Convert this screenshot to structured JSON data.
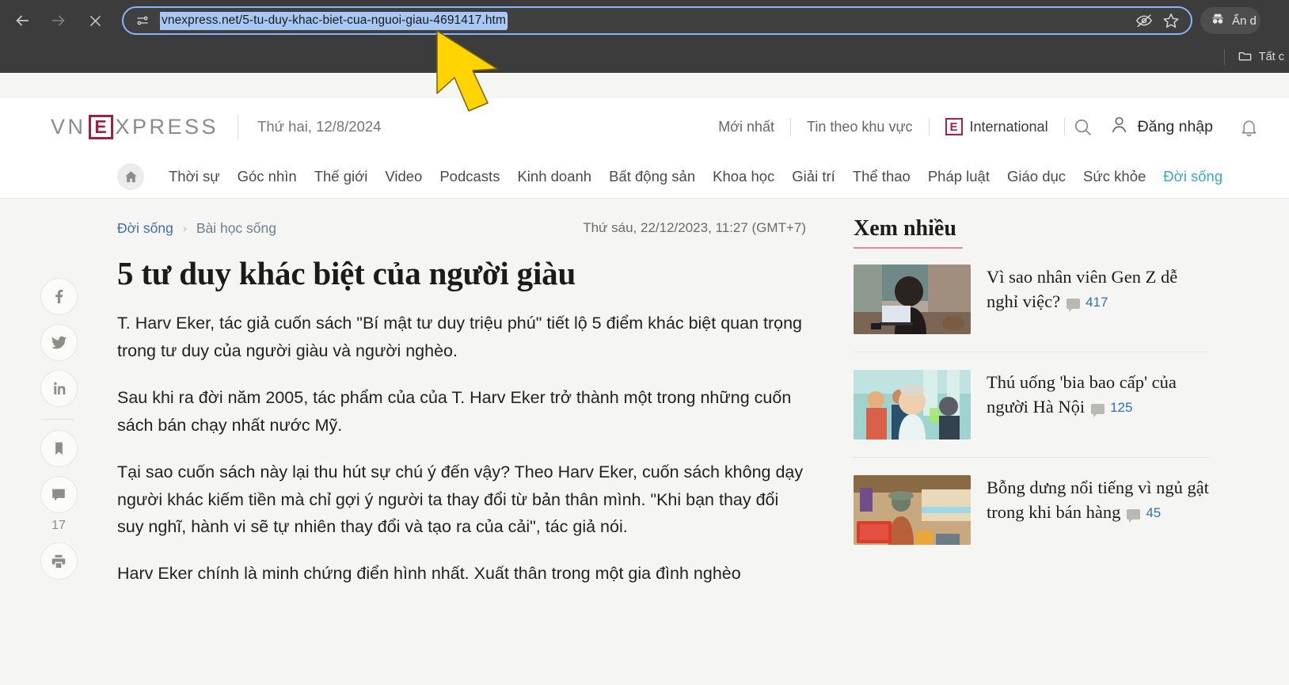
{
  "browser": {
    "back_label": "←",
    "forward_label": "→",
    "stop_label": "✕",
    "url": "vnexpress.net/5-tu-duy-khac-biet-cua-nguoi-giau-4691417.html",
    "lead_icon": "tune-sliders-icon",
    "hide_icon": "eye-slash-icon",
    "bookmark_star_icon": "star-icon",
    "incognito_label": "Ẩn d",
    "bookmark_folder_label": "Tất c",
    "accent_focus": "#8ab4f8",
    "chrome_bg": "#3c3c3c",
    "selection_bg": "#a7c8f5"
  },
  "site_header": {
    "logo_prefix": "VN",
    "logo_box": "E",
    "logo_suffix": "XPRESS",
    "date": "Thứ hai, 12/8/2024",
    "links": [
      "Mới nhất",
      "Tin theo khu vực"
    ],
    "international_label": "International",
    "international_badge": "E",
    "search_icon": "search-icon",
    "login_label": "Đăng nhập",
    "user_icon": "user-icon",
    "bell_icon": "bell-icon",
    "brand_color": "#9f1f45"
  },
  "nav": {
    "home_icon": "home-icon",
    "items": [
      {
        "label": "Thời sự",
        "active": false
      },
      {
        "label": "Góc nhìn",
        "active": false
      },
      {
        "label": "Thế giới",
        "active": false
      },
      {
        "label": "Video",
        "active": false
      },
      {
        "label": "Podcasts",
        "active": false
      },
      {
        "label": "Kinh doanh",
        "active": false
      },
      {
        "label": "Bất động sản",
        "active": false
      },
      {
        "label": "Khoa học",
        "active": false
      },
      {
        "label": "Giải trí",
        "active": false
      },
      {
        "label": "Thể thao",
        "active": false
      },
      {
        "label": "Pháp luật",
        "active": false
      },
      {
        "label": "Giáo dục",
        "active": false
      },
      {
        "label": "Sức khỏe",
        "active": false
      },
      {
        "label": "Đời sống",
        "active": true
      }
    ],
    "menu_icon": "hamburger-icon",
    "active_color": "#3aa7c4"
  },
  "share_rail": {
    "buttons": [
      {
        "name": "facebook-icon",
        "glyph": "f"
      },
      {
        "name": "twitter-icon",
        "glyph": "t"
      },
      {
        "name": "linkedin-icon",
        "glyph": "in"
      },
      {
        "name": "bookmark-icon",
        "glyph": "bm"
      },
      {
        "name": "comment-icon",
        "glyph": "cm"
      },
      {
        "name": "print-icon",
        "glyph": "pr"
      }
    ],
    "comment_count": "17"
  },
  "article": {
    "breadcrumb": {
      "category": "Đời sống",
      "separator": "›",
      "subcategory": "Bài học sống"
    },
    "timestamp": "Thứ sáu, 22/12/2023, 11:27 (GMT+7)",
    "title": "5 tư duy khác biệt của người giàu",
    "paragraphs": [
      "T. Harv Eker, tác giả cuốn sách \"Bí mật tư duy triệu phú\" tiết lộ 5 điểm khác biệt quan trọng trong tư duy của người giàu và người nghèo.",
      "Sau khi ra đời năm 2005, tác phẩm của của T. Harv Eker trở thành một trong những cuốn sách bán chạy nhất nước Mỹ.",
      "Tại sao cuốn sách này lại thu hút sự chú ý đến vậy? Theo Harv Eker, cuốn sách không dạy người khác kiếm tiền mà chỉ gợi ý người ta thay đổi từ bản thân mình. \"Khi bạn thay đổi suy nghĩ, hành vi sẽ tự nhiên thay đổi và tạo ra của cải\", tác giả nói.",
      "Harv Eker chính là minh chứng điển hình nhất. Xuất thân trong một gia đình nghèo"
    ]
  },
  "sidebar": {
    "title": "Xem nhiều",
    "items": [
      {
        "title": "Vì sao nhân viên Gen Z dễ nghỉ việc?",
        "comments": "417",
        "thumb": "woman-at-laptop-photo"
      },
      {
        "title": "Thú uống 'bia bao cấp' của người Hà Nội",
        "comments": "125",
        "thumb": "elderly-man-with-beer-photo"
      },
      {
        "title": "Bỗng dưng nổi tiếng vì ngủ gật trong khi bán hàng",
        "comments": "45",
        "thumb": "street-vendor-photo"
      }
    ],
    "underline_color": "#d98a9e",
    "comment_link_color": "#2f6fb0"
  },
  "cursor": {
    "icon": "arrow-cursor",
    "color": "#FFD400"
  }
}
